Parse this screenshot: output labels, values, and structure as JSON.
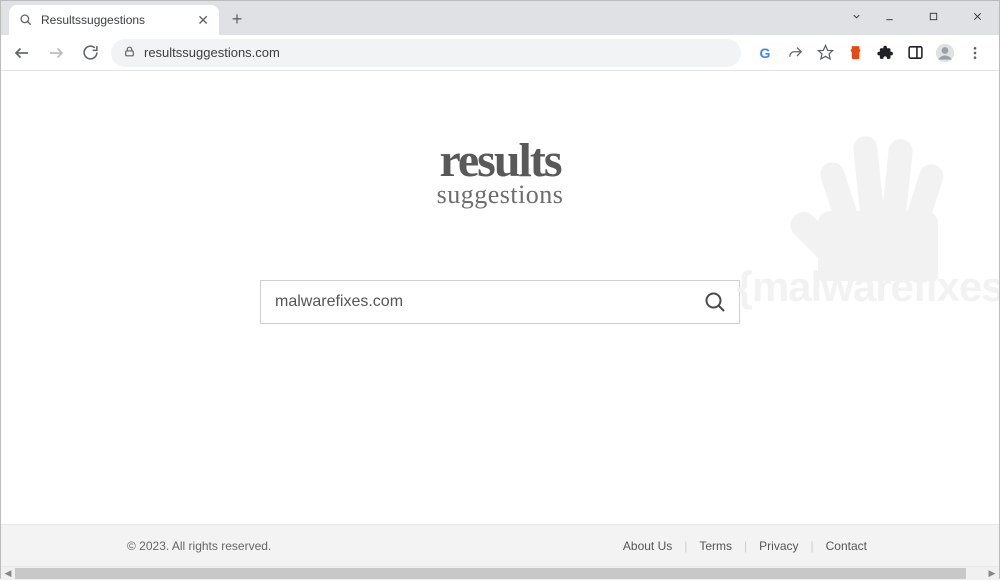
{
  "window": {
    "tab_title": "Resultssuggestions"
  },
  "toolbar": {
    "url": "resultssuggestions.com"
  },
  "page": {
    "logo_main": "results",
    "logo_sub": "suggestions",
    "search_value": "malwarefixes.com",
    "watermark_text": "{malwarefixes}"
  },
  "footer": {
    "copyright": "© 2023. All rights reserved.",
    "links": [
      "About Us",
      "Terms",
      "Privacy",
      "Contact"
    ]
  }
}
